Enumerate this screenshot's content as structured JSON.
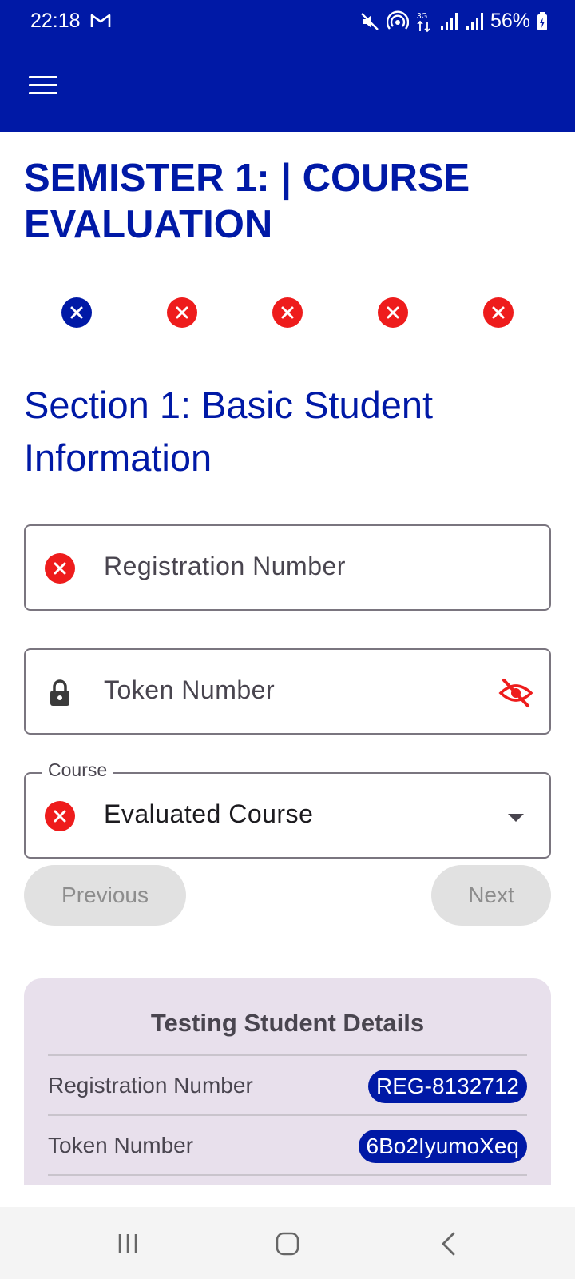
{
  "status_bar": {
    "time": "22:18",
    "battery": "56%",
    "network": "3G"
  },
  "app_bar": {
    "menu_icon": "menu-icon"
  },
  "page": {
    "title": "SEMISTER 1: | COURSE EVALUATION"
  },
  "stepper": {
    "steps": [
      {
        "state": "active"
      },
      {
        "state": "error"
      },
      {
        "state": "error"
      },
      {
        "state": "error"
      },
      {
        "state": "error"
      }
    ]
  },
  "section": {
    "title": "Section 1: Basic Student Information"
  },
  "form": {
    "registration": {
      "placeholder": "Registration Number",
      "icon": "error-icon"
    },
    "token": {
      "placeholder": "Token Number",
      "leading_icon": "lock-icon",
      "trailing_icon": "visibility-off-icon"
    },
    "course": {
      "label": "Course",
      "value": "Evaluated Course",
      "icon": "error-icon",
      "trailing_icon": "dropdown-arrow-icon"
    }
  },
  "buttons": {
    "previous": "Previous",
    "next": "Next"
  },
  "card": {
    "title": "Testing Student Details",
    "rows": [
      {
        "label": "Registration Number",
        "value": "REG-8132712"
      },
      {
        "label": "Token Number",
        "value": "6Bo2IyumoXeq"
      }
    ]
  },
  "colors": {
    "primary": "#0019a6",
    "error": "#ee1c1c",
    "card_bg": "#e8e0ec",
    "disabled_bg": "#e1e1e1"
  },
  "navigation_bar": {
    "buttons": [
      "recents-icon",
      "home-icon",
      "back-icon"
    ]
  }
}
